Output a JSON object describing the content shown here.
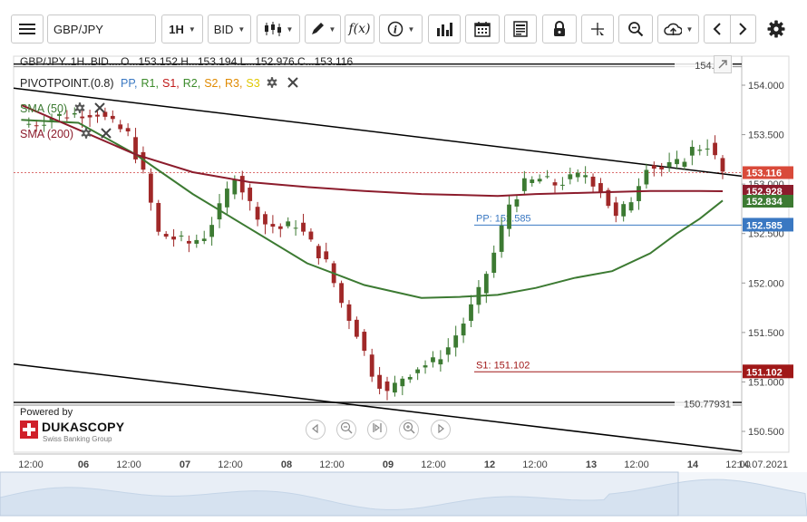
{
  "toolbar": {
    "symbol": "GBP/JPY",
    "timeframe": "1H",
    "price_side": "BID",
    "icons": [
      "menu-icon",
      "candlestick-icon",
      "pencil-icon",
      "function-icon",
      "info-icon",
      "bar-chart-icon",
      "calendar-icon",
      "report-icon",
      "lock-icon",
      "crosshair-icon",
      "zoom-icon",
      "cloud-upload-icon",
      "arrow-left-icon",
      "arrow-right-icon",
      "gear-icon"
    ]
  },
  "header": {
    "ohlc": "GBP/JPY..1H..BID....O...153.152.H...153.194.L...152.976.C...153.116",
    "pivot_label": "PIVOTPOINT.(0.8)",
    "pivot_levels": [
      {
        "text": "PP,",
        "color": "#3a78c2"
      },
      {
        "text": "R1,",
        "color": "#3b8a2a"
      },
      {
        "text": "S1,",
        "color": "#c01818"
      },
      {
        "text": "R2,",
        "color": "#3b8a2a"
      },
      {
        "text": "S2,",
        "color": "#e08a00"
      },
      {
        "text": "R3,",
        "color": "#e08a00"
      },
      {
        "text": "S3",
        "color": "#e0c800"
      }
    ],
    "sma50_label": "SMA (50)",
    "sma200_label": "SMA (200)"
  },
  "powered": {
    "line1": "Powered by",
    "brand": "DUKASCOPY",
    "tagline": "Swiss Banking Group"
  },
  "colors": {
    "candle_up": "#3c7a32",
    "candle_down": "#a02828",
    "sma50": "#3c7a32",
    "sma200": "#8c1c2c",
    "pp": "#3a78c2",
    "s1": "#a01818",
    "trend": "#000000",
    "close_line": "#d04040"
  },
  "chart_data": {
    "type": "candlestick",
    "symbol": "GBP/JPY",
    "interval": "1H",
    "ohlc": {
      "open": 153.152,
      "high": 153.194,
      "low": 152.976,
      "close": 153.116
    },
    "y_axis": {
      "ticks": [
        150.5,
        151.0,
        151.5,
        152.0,
        152.5,
        153.0,
        153.5,
        154.0
      ],
      "tick_labels": [
        "150.500",
        "151.000",
        "151.500",
        "152.000",
        "152.500",
        "153.000",
        "153.500",
        "154.000"
      ],
      "range": [
        150.2,
        154.35
      ]
    },
    "x_axis": {
      "tick_labels": [
        "12:00",
        "06",
        "12:00",
        "07",
        "12:00",
        "08",
        "12:00",
        "09",
        "12:00",
        "12",
        "12:00",
        "13",
        "12:00",
        "14",
        "12:00"
      ],
      "end_label": "14.07.2021"
    },
    "horizontal_levels": [
      {
        "name": "154.200",
        "value": 154.2,
        "label": "154.200"
      },
      {
        "name": "150.77931",
        "value": 150.77931,
        "label": "150.77931"
      }
    ],
    "pivot_levels": [
      {
        "name": "PP",
        "value": 152.585,
        "label": "PP: 152.585",
        "badge": "152.585"
      },
      {
        "name": "S1",
        "value": 151.102,
        "label": "S1: 151.102",
        "badge": "151.102"
      }
    ],
    "price_badges": [
      {
        "name": "last",
        "value": 153.116,
        "label": "153.116"
      },
      {
        "name": "sma200",
        "value": 152.928,
        "label": "152.928"
      },
      {
        "name": "sma50",
        "value": 152.834,
        "label": "152.834"
      }
    ],
    "trend_lines": [
      {
        "name": "upper-channel",
        "from": {
          "x": -12,
          "y": 153.97
        },
        "to": {
          "x": 179,
          "y": 153.08
        }
      },
      {
        "name": "lower-channel",
        "from": {
          "x": -12,
          "y": 151.18
        },
        "to": {
          "x": 179,
          "y": 150.3
        }
      }
    ],
    "series": [
      {
        "name": "SMA (50)",
        "x": [
          -10,
          5,
          20,
          35,
          50,
          65,
          80,
          95,
          105,
          115,
          125,
          135,
          145,
          155,
          162,
          168,
          174
        ],
        "y": [
          153.65,
          153.62,
          153.3,
          152.9,
          152.55,
          152.2,
          151.98,
          151.85,
          151.86,
          151.88,
          151.95,
          152.05,
          152.12,
          152.3,
          152.5,
          152.65,
          152.834
        ]
      },
      {
        "name": "SMA (200)",
        "x": [
          -10,
          5,
          20,
          35,
          50,
          65,
          80,
          95,
          105,
          115,
          125,
          135,
          145,
          155,
          162,
          168,
          174
        ],
        "y": [
          153.8,
          153.55,
          153.3,
          153.12,
          153.02,
          152.97,
          152.93,
          152.9,
          152.89,
          152.88,
          152.9,
          152.91,
          152.92,
          152.93,
          152.93,
          152.93,
          152.928
        ]
      },
      {
        "name": "GBP/JPY",
        "x": [
          -10,
          -6,
          -2,
          2,
          6,
          10,
          14,
          18,
          22,
          26,
          30,
          34,
          38,
          42,
          46,
          50,
          54,
          58,
          62,
          66,
          70,
          74,
          78,
          82,
          86,
          90,
          94,
          98,
          102,
          106,
          110,
          114,
          118,
          122,
          126,
          130,
          134,
          138,
          142,
          146,
          150,
          154,
          158,
          162,
          166,
          170,
          174
        ],
        "y": [
          153.6,
          153.62,
          153.68,
          153.7,
          153.72,
          153.72,
          153.6,
          153.5,
          153.1,
          152.5,
          152.45,
          152.4,
          152.48,
          152.75,
          153.1,
          152.8,
          152.6,
          152.55,
          152.6,
          152.4,
          152.2,
          151.8,
          151.5,
          151.1,
          150.88,
          151.05,
          151.15,
          151.2,
          151.35,
          151.6,
          151.9,
          152.3,
          152.8,
          153.0,
          153.05,
          153.0,
          153.05,
          153.1,
          152.95,
          152.65,
          152.85,
          153.2,
          153.15,
          153.2,
          153.35,
          153.4,
          153.116
        ]
      }
    ]
  }
}
